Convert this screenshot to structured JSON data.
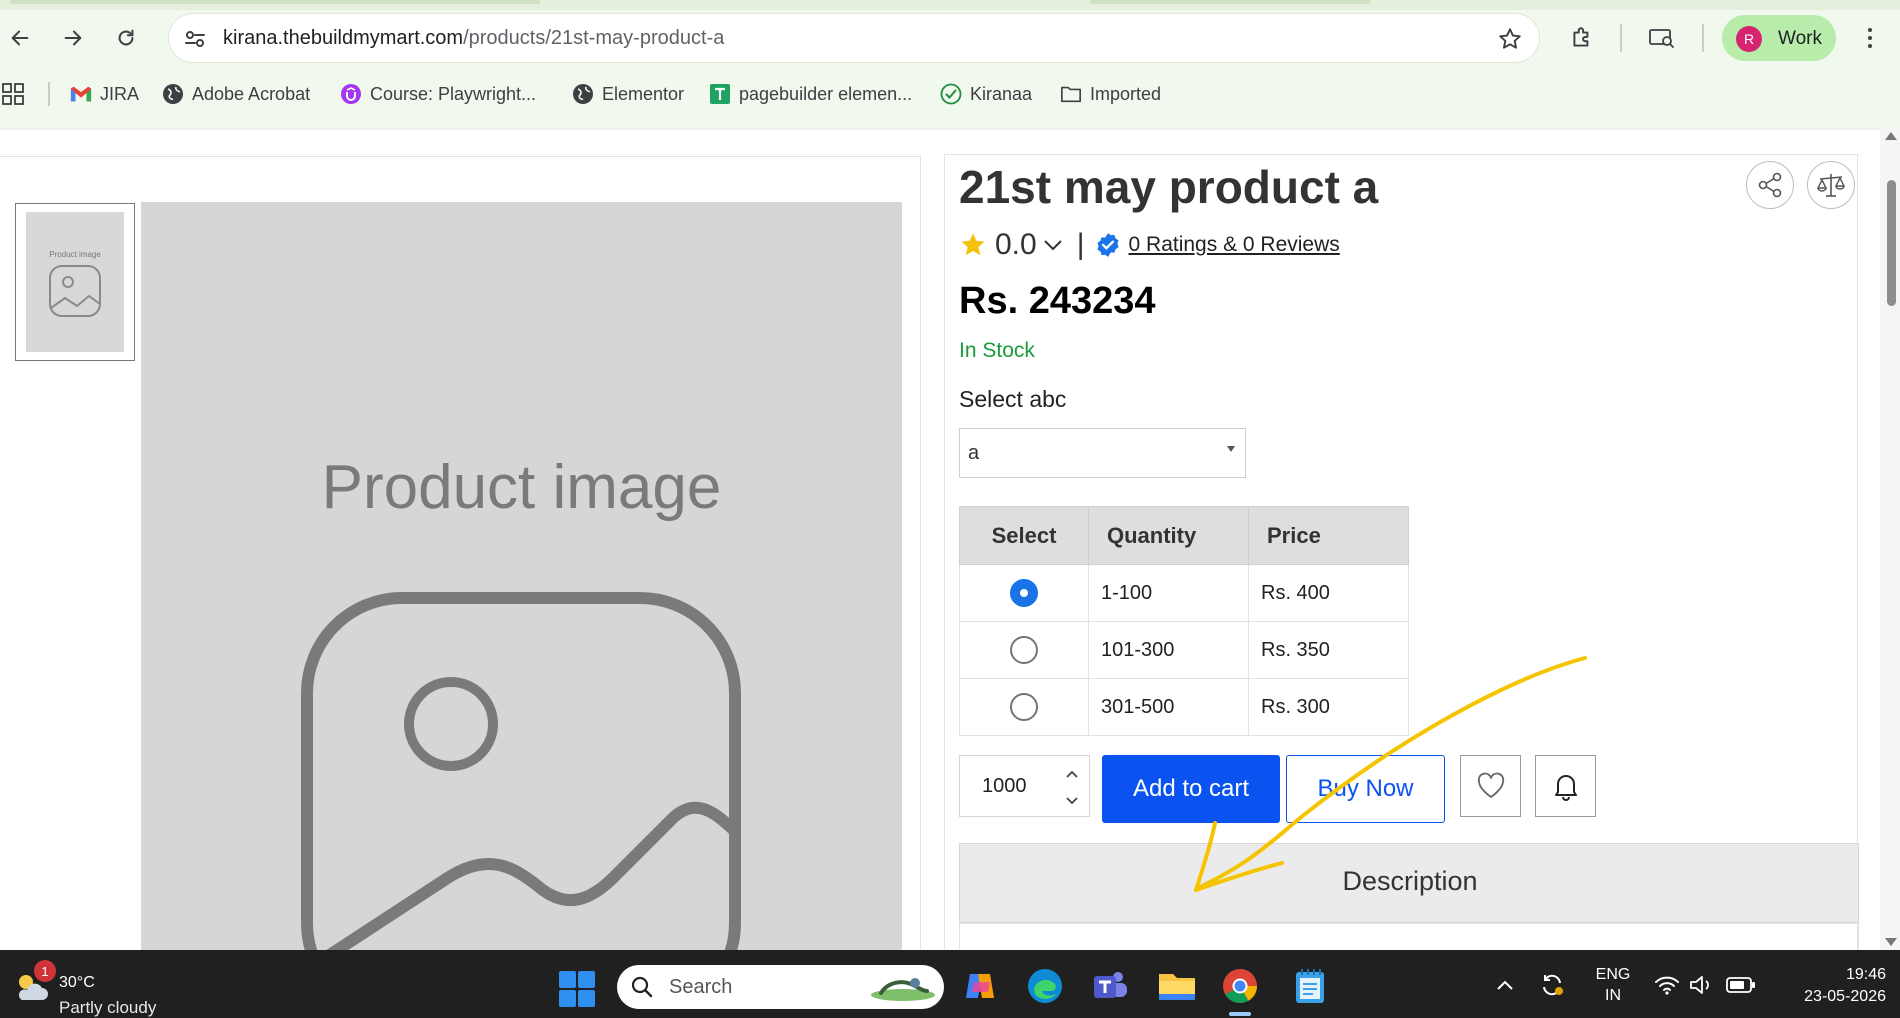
{
  "browser": {
    "url_host": "kirana.thebuildmymart.com",
    "url_path": "/products/21st-may-product-a",
    "profile_initial": "R",
    "profile_label": "Work",
    "bookmarks": [
      {
        "label": "JIRA",
        "icon": "gmail-icon"
      },
      {
        "label": "Adobe Acrobat",
        "icon": "globe-icon"
      },
      {
        "label": "Course: Playwright...",
        "icon": "udemy-icon"
      },
      {
        "label": "Elementor",
        "icon": "globe-icon"
      },
      {
        "label": "pagebuilder elemen...",
        "icon": "sheets-icon"
      },
      {
        "label": "Kiranaa",
        "icon": "check-circle-icon"
      },
      {
        "label": "Imported",
        "icon": "folder-icon"
      }
    ]
  },
  "product": {
    "title": "21st may product a",
    "rating_value": "0.0",
    "reviews_link": "0 Ratings  & 0 Reviews",
    "price": "Rs. 243234",
    "stock_status": "In Stock",
    "variant_label": "Select abc",
    "variant_selected": "a",
    "image_label": "Product image",
    "thumb_label": "Product image"
  },
  "pricing_table": {
    "headers": [
      "Select",
      "Quantity",
      "Price"
    ],
    "rows": [
      {
        "quantity": "1-100",
        "price": "Rs. 400",
        "selected": true
      },
      {
        "quantity": "101-300",
        "price": "Rs. 350",
        "selected": false
      },
      {
        "quantity": "301-500",
        "price": "Rs. 300",
        "selected": false
      }
    ]
  },
  "actions": {
    "quantity_value": "1000",
    "add_to_cart": "Add to cart",
    "buy_now": "Buy Now"
  },
  "description": {
    "heading": "Description"
  },
  "taskbar": {
    "weather_temp": "30°C",
    "weather_desc": "Partly cloudy",
    "weather_badge": "1",
    "search_placeholder": "Search",
    "lang_line1": "ENG",
    "lang_line2": "IN",
    "time": "19:46",
    "date": "23-05-2026"
  },
  "colors": {
    "primary_button": "#0a53f0",
    "stock_green": "#1a9b3a",
    "annotation_arrow": "#f5c400",
    "chrome_bg": "#f1f8ed"
  }
}
